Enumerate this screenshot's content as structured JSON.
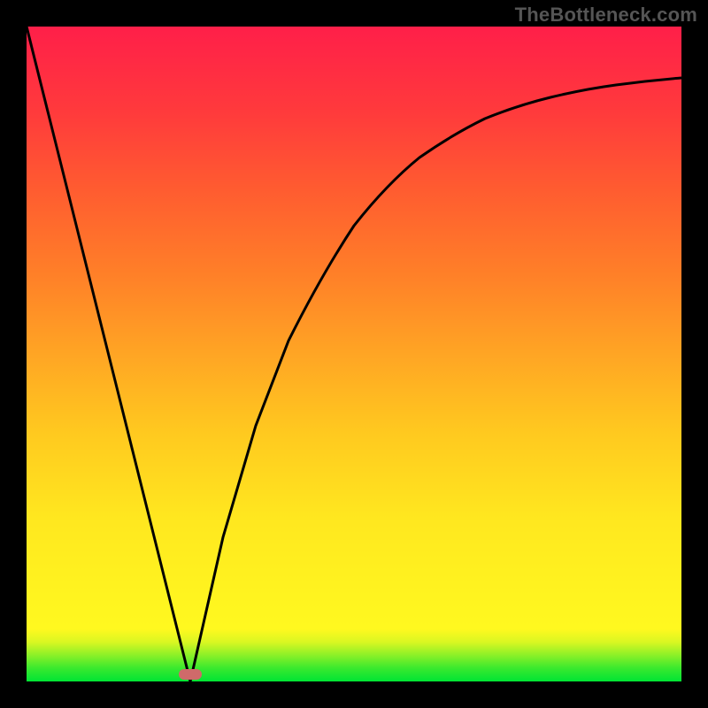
{
  "watermark": "TheBottleneck.com",
  "chart_data": {
    "type": "line",
    "title": "",
    "xlabel": "",
    "ylabel": "",
    "xlim": [
      0,
      100
    ],
    "ylim": [
      0,
      100
    ],
    "grid": false,
    "legend": false,
    "series": [
      {
        "name": "left-linear-slope",
        "x": [
          0,
          25
        ],
        "y": [
          100,
          0
        ]
      },
      {
        "name": "right-curve",
        "x": [
          25,
          30,
          35,
          40,
          45,
          50,
          55,
          60,
          65,
          70,
          75,
          80,
          85,
          90,
          95,
          100
        ],
        "y": [
          0,
          22,
          39,
          52,
          62,
          69.5,
          75.5,
          80,
          83.5,
          86,
          88,
          89.5,
          90.5,
          91.5,
          92,
          92.5
        ]
      }
    ],
    "marker": {
      "x": 25,
      "y": 0,
      "color": "#cf6a6a",
      "shape": "pill"
    },
    "background_gradient": {
      "orientation": "vertical",
      "stops": [
        {
          "pos": 0.0,
          "color": "#00e434"
        },
        {
          "pos": 0.06,
          "color": "#d9f722"
        },
        {
          "pos": 0.12,
          "color": "#fff51f"
        },
        {
          "pos": 0.5,
          "color": "#ffa524"
        },
        {
          "pos": 0.87,
          "color": "#ff3a3c"
        },
        {
          "pos": 1.0,
          "color": "#ff1f49"
        }
      ]
    }
  }
}
